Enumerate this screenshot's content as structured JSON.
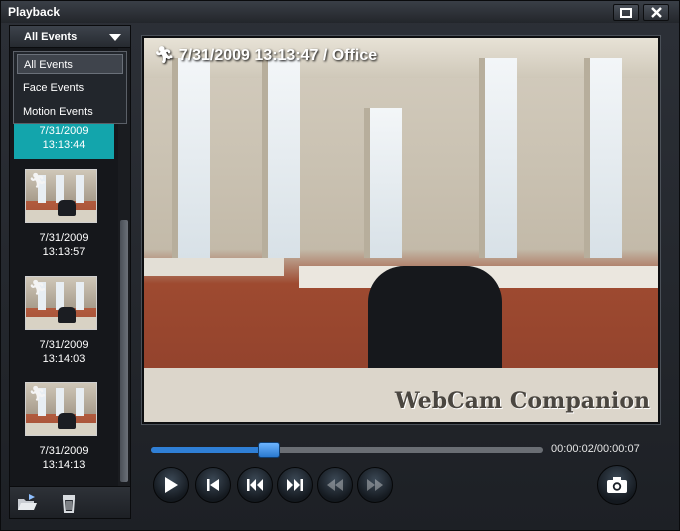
{
  "window": {
    "title": "Playback"
  },
  "sidebar": {
    "filter_selected": "All Events",
    "filter_options": [
      "All Events",
      "Face Events",
      "Motion Events"
    ],
    "events": [
      {
        "date": "7/31/2009",
        "time": "13:13:44"
      },
      {
        "date": "7/31/2009",
        "time": "13:13:57"
      },
      {
        "date": "7/31/2009",
        "time": "13:14:03"
      },
      {
        "date": "7/31/2009",
        "time": "13:14:13"
      }
    ]
  },
  "video": {
    "overlay": "7/31/2009 13:13:47 / Office",
    "watermark": "WebCam Companion"
  },
  "playback": {
    "time": "00:00:02/00:00:07",
    "progress_fraction": 0.3
  },
  "colors": {
    "accent": "#13a5ac",
    "seek": "#2f7fd6"
  }
}
